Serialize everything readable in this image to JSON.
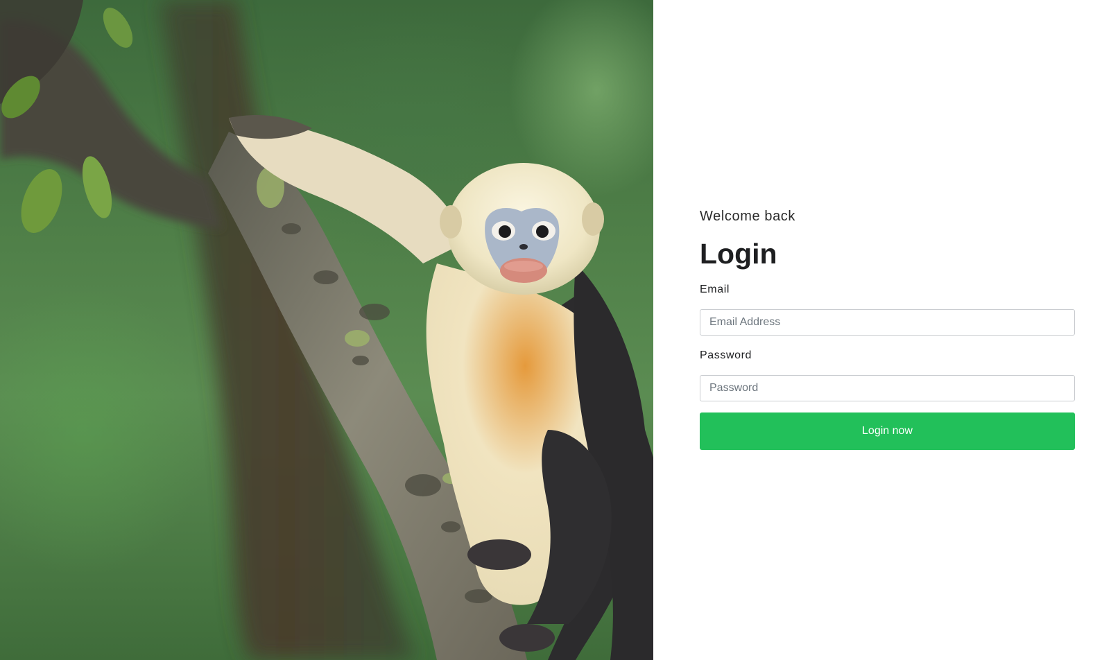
{
  "hero": {
    "image": "golden-snub-nosed-monkey-on-tree-photo"
  },
  "login": {
    "welcome": "Welcome back",
    "title": "Login",
    "email_label": "Email",
    "email_placeholder": "Email Address",
    "email_value": "",
    "password_label": "Password",
    "password_placeholder": "Password",
    "password_value": "",
    "submit_label": "Login now"
  },
  "colors": {
    "accent": "#22c05a",
    "text": "#1e1f21",
    "input_border": "#c9ccd0",
    "background": "#ffffff"
  }
}
